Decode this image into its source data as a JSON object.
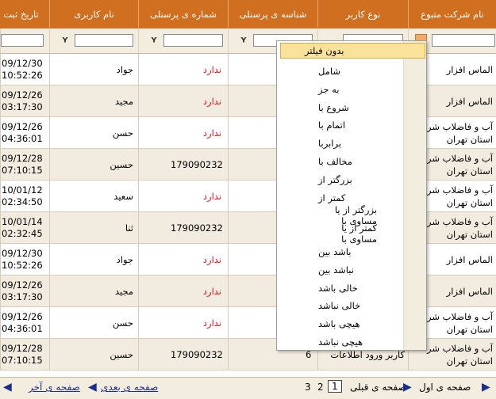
{
  "columns": [
    {
      "key": "company",
      "label": "نام شرکت متبوع"
    },
    {
      "key": "user_type",
      "label": "نوع کاربر"
    },
    {
      "key": "personnel_id",
      "label": "شناسه ی پرسنلی"
    },
    {
      "key": "personnel_no",
      "label": "شماره ی پرسنلی"
    },
    {
      "key": "username",
      "label": "نام کاربری"
    },
    {
      "key": "date",
      "label": "تاریخ ثبت"
    }
  ],
  "filter_icon": "filter-funnel-icon",
  "rows": [
    {
      "date": "09/12/30",
      "time": "10:52:26",
      "user": "جواد",
      "pers": "ندارد",
      "pers_none": true,
      "id": "",
      "type": "",
      "comp": [
        "الماس افزار"
      ]
    },
    {
      "date": "09/12/26",
      "time": "03:17:30",
      "user": "مجید",
      "pers": "ندارد",
      "pers_none": true,
      "id": "",
      "type": "",
      "comp": [
        "الماس افزار"
      ]
    },
    {
      "date": "09/12/26",
      "time": "04:36:01",
      "user": "حسن",
      "pers": "ندارد",
      "pers_none": true,
      "id": "",
      "type": "",
      "comp": [
        "آب و فاضلاب شر",
        "استان تهران"
      ]
    },
    {
      "date": "09/12/28",
      "time": "07:10:15",
      "user": "حسین",
      "pers": "179090232",
      "pers_none": false,
      "id": "",
      "type": "",
      "comp": [
        "آب و فاضلاب شر",
        "استان تهران"
      ]
    },
    {
      "date": "10/01/12",
      "time": "02:34:50",
      "user": "سعید",
      "pers": "ندارد",
      "pers_none": true,
      "id": "",
      "type": "",
      "comp": [
        "آب و فاضلاب شر",
        "استان تهران"
      ]
    },
    {
      "date": "10/01/14",
      "time": "02:32:45",
      "user": "ثنا",
      "pers": "179090232",
      "pers_none": false,
      "id": "",
      "type": "",
      "comp": [
        "آب و فاضلاب شر",
        "استان تهران"
      ]
    },
    {
      "date": "09/12/30",
      "time": "10:52:26",
      "user": "جواد",
      "pers": "ندارد",
      "pers_none": true,
      "id": "",
      "type": "",
      "comp": [
        "الماس افزار"
      ]
    },
    {
      "date": "09/12/26",
      "time": "03:17:30",
      "user": "مجید",
      "pers": "ندارد",
      "pers_none": true,
      "id": "",
      "type": "",
      "comp": [
        "الماس افزار"
      ]
    },
    {
      "date": "09/12/26",
      "time": "04:36:01",
      "user": "حسن",
      "pers": "ندارد",
      "pers_none": true,
      "id": "",
      "type": "",
      "comp": [
        "آب و فاضلاب شر",
        "استان تهران"
      ]
    },
    {
      "date": "09/12/28",
      "time": "07:10:15",
      "user": "حسین",
      "pers": "179090232",
      "pers_none": false,
      "id": "6",
      "type": "کاربر ورود اطلاعات",
      "comp": [
        "آب و فاضلاب شر",
        "استان تهران"
      ]
    }
  ],
  "filter_menu": {
    "selected": "بدون فیلتر",
    "items": [
      "شامل",
      "به جز",
      "شروع با",
      "اتمام با",
      "برابربا",
      "مخالف با",
      "بزرگتر از",
      "کمتر از",
      "بزرگتر از یا مساوی با",
      "کمتر از یا مساوی با",
      "باشد بین",
      "نباشد بین",
      "خالی باشد",
      "خالی نباشد",
      "هیچی باشد",
      "هیچی نباشد"
    ]
  },
  "pager": {
    "first": "صفحه ی اول",
    "prev": "صفحه ی قبلی",
    "pages": [
      "1",
      "2",
      "3"
    ],
    "current": "1",
    "next": "صفحه ی بعدی",
    "last": "صفحه ی آخر"
  }
}
